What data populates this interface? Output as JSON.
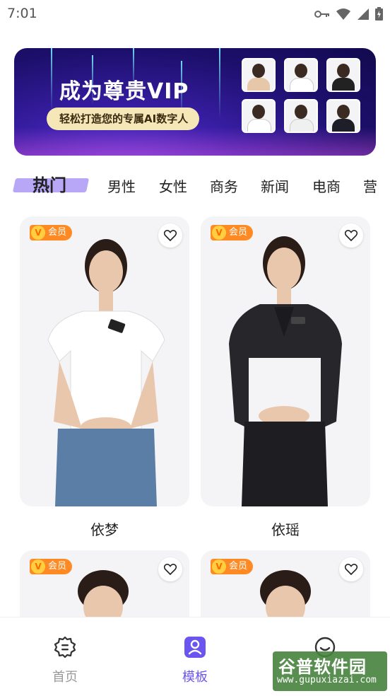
{
  "status": {
    "time": "7:01"
  },
  "banner": {
    "title": "成为尊贵VIP",
    "subtitle": "轻松打造您的专属AI数字人"
  },
  "tabs": [
    {
      "label": "热门"
    },
    {
      "label": "男性"
    },
    {
      "label": "女性"
    },
    {
      "label": "商务"
    },
    {
      "label": "新闻"
    },
    {
      "label": "电商"
    },
    {
      "label": "营"
    }
  ],
  "cards": [
    {
      "name": "依梦",
      "badge": "会员",
      "badge_icon": "V"
    },
    {
      "name": "依瑶",
      "badge": "会员",
      "badge_icon": "V"
    },
    {
      "badge": "会员",
      "badge_icon": "V"
    },
    {
      "badge": "会员",
      "badge_icon": "V"
    }
  ],
  "nav": {
    "home": "首页",
    "templates": "模板"
  },
  "watermark": {
    "title": "谷普软件园",
    "url": "www.gupuxiazai.com"
  },
  "colors": {
    "accent": "#6b55f0",
    "badge": "#ff8a24",
    "banner": "#1c0f6b"
  }
}
